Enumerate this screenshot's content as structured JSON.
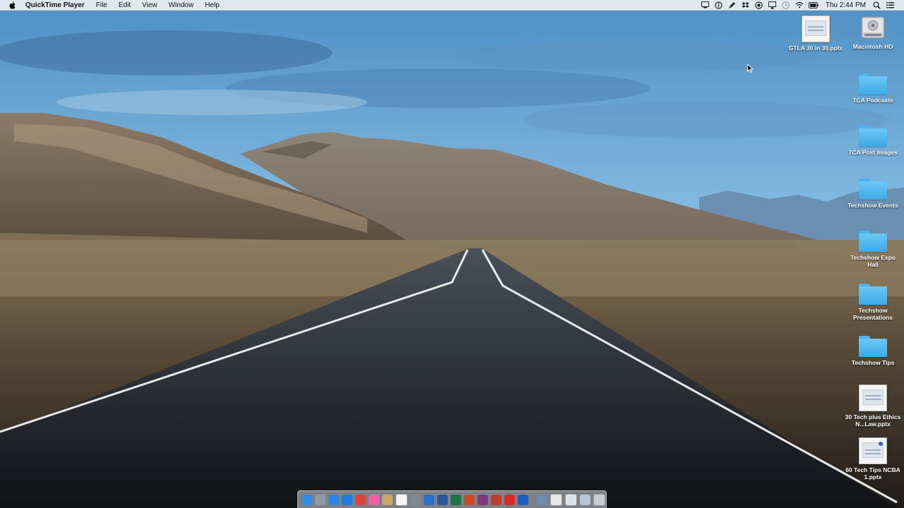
{
  "menubar": {
    "apple_icon": "apple-icon",
    "app_name": "QuickTime Player",
    "menus": [
      "File",
      "Edit",
      "View",
      "Window",
      "Help"
    ],
    "status_icons": [
      "display-icon",
      "info-icon",
      "pen-icon",
      "dropbox-icon",
      "record-icon",
      "airplay-icon",
      "timemachine-icon",
      "wifi-icon",
      "battery-icon"
    ],
    "clock": "Thu 2:44 PM",
    "right_icons": [
      "spotlight-icon",
      "notification-center-icon"
    ]
  },
  "desktop": {
    "items": [
      {
        "label": "GTLA 30 in 30.pptx",
        "type": "document"
      },
      {
        "label": "Macintosh HD",
        "type": "drive"
      },
      {
        "label": "TCA Podcasts",
        "type": "folder"
      },
      {
        "label": "TCA Post Images",
        "type": "folder"
      },
      {
        "label": "Techshow Events",
        "type": "folder"
      },
      {
        "label": "Techshow Expo Hall",
        "type": "folder"
      },
      {
        "label": "Techshow Presentations",
        "type": "folder"
      },
      {
        "label": "Techshow Tips",
        "type": "folder"
      },
      {
        "label": "30 Tech plus Ethics N...Law.pptx",
        "type": "document"
      },
      {
        "label": "60 Tech Tips NCBA 1.pptx",
        "type": "document"
      }
    ]
  },
  "dock": {
    "apps": [
      {
        "icon": "finder-icon",
        "color": "#2f8de4"
      },
      {
        "icon": "launchpad-icon",
        "color": "#8e9aa8"
      },
      {
        "icon": "safari-icon",
        "color": "#2a86e8"
      },
      {
        "icon": "appstore-icon",
        "color": "#1e7be0"
      },
      {
        "icon": "chrome-icon",
        "color": "#e04336"
      },
      {
        "icon": "itunes-icon",
        "color": "#f45ea9"
      },
      {
        "icon": "notes-icon",
        "color": "#c9a56a"
      },
      {
        "icon": "calendar-icon",
        "color": "#f3f3f3"
      },
      {
        "icon": "preferences-icon",
        "color": "#7f8893"
      },
      {
        "icon": "vlc-icon",
        "color": "#2b6fc6"
      },
      {
        "icon": "word-icon",
        "color": "#2b579a"
      },
      {
        "icon": "excel-icon",
        "color": "#217346"
      },
      {
        "icon": "powerpoint-icon",
        "color": "#d24726"
      },
      {
        "icon": "onenote-icon",
        "color": "#80397b"
      },
      {
        "icon": "pdfpen-icon",
        "color": "#c0392b"
      },
      {
        "icon": "acrobat-icon",
        "color": "#d62b2b"
      },
      {
        "icon": "browser-icon",
        "color": "#1f5fbf"
      }
    ],
    "others": [
      {
        "icon": "screenshot-icon",
        "color": "#6d8cb0"
      },
      {
        "icon": "document-stack-icon",
        "color": "#e8e8e8"
      },
      {
        "icon": "downloads-icon",
        "color": "#dde3ea"
      },
      {
        "icon": "folder-stack-icon",
        "color": "#b7c7d6"
      },
      {
        "icon": "trash-icon",
        "color": "#c8ccd1"
      }
    ]
  }
}
